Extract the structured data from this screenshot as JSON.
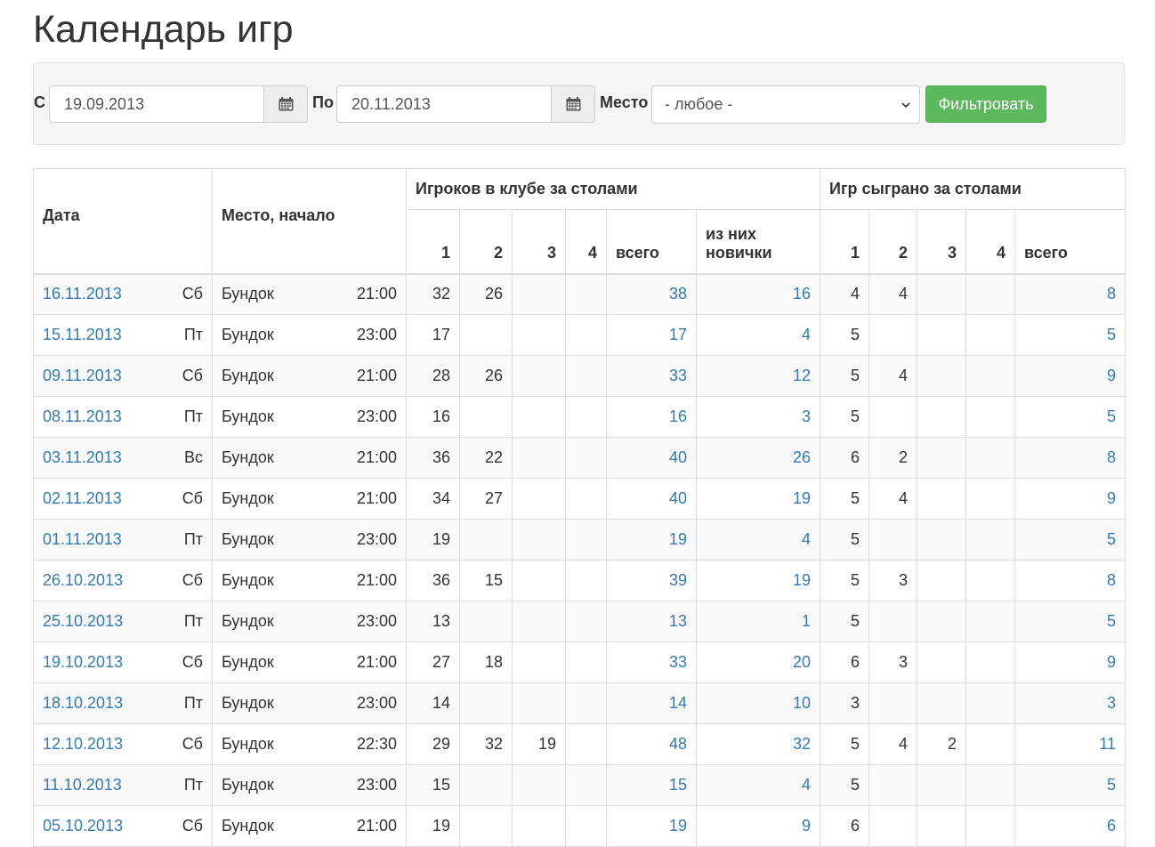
{
  "page_title": "Календарь игр",
  "filter": {
    "from_label": "С",
    "from_value": "19.09.2013",
    "to_label": "По",
    "to_value": "20.11.2013",
    "place_label": "Место",
    "place_value": "- любое -",
    "submit_label": "Фильтровать"
  },
  "table": {
    "headers": {
      "date": "Дата",
      "place_start": "Место, начало",
      "players_group": "Игроков в клубе за столами",
      "games_group": "Игр сыграно за столами",
      "t1": "1",
      "t2": "2",
      "t3": "3",
      "t4": "4",
      "total": "всего",
      "newbies": "из них новички"
    },
    "rows": [
      {
        "date": "16.11.2013",
        "dow": "Сб",
        "place": "Бундок",
        "time": "21:00",
        "p1": "32",
        "p2": "26",
        "p3": "",
        "p4": "",
        "ptotal": "38",
        "pnew": "16",
        "g1": "4",
        "g2": "4",
        "g3": "",
        "g4": "",
        "gtotal": "8"
      },
      {
        "date": "15.11.2013",
        "dow": "Пт",
        "place": "Бундок",
        "time": "23:00",
        "p1": "17",
        "p2": "",
        "p3": "",
        "p4": "",
        "ptotal": "17",
        "pnew": "4",
        "g1": "5",
        "g2": "",
        "g3": "",
        "g4": "",
        "gtotal": "5"
      },
      {
        "date": "09.11.2013",
        "dow": "Сб",
        "place": "Бундок",
        "time": "21:00",
        "p1": "28",
        "p2": "26",
        "p3": "",
        "p4": "",
        "ptotal": "33",
        "pnew": "12",
        "g1": "5",
        "g2": "4",
        "g3": "",
        "g4": "",
        "gtotal": "9"
      },
      {
        "date": "08.11.2013",
        "dow": "Пт",
        "place": "Бундок",
        "time": "23:00",
        "p1": "16",
        "p2": "",
        "p3": "",
        "p4": "",
        "ptotal": "16",
        "pnew": "3",
        "g1": "5",
        "g2": "",
        "g3": "",
        "g4": "",
        "gtotal": "5"
      },
      {
        "date": "03.11.2013",
        "dow": "Вс",
        "place": "Бундок",
        "time": "21:00",
        "p1": "36",
        "p2": "22",
        "p3": "",
        "p4": "",
        "ptotal": "40",
        "pnew": "26",
        "g1": "6",
        "g2": "2",
        "g3": "",
        "g4": "",
        "gtotal": "8"
      },
      {
        "date": "02.11.2013",
        "dow": "Сб",
        "place": "Бундок",
        "time": "21:00",
        "p1": "34",
        "p2": "27",
        "p3": "",
        "p4": "",
        "ptotal": "40",
        "pnew": "19",
        "g1": "5",
        "g2": "4",
        "g3": "",
        "g4": "",
        "gtotal": "9"
      },
      {
        "date": "01.11.2013",
        "dow": "Пт",
        "place": "Бундок",
        "time": "23:00",
        "p1": "19",
        "p2": "",
        "p3": "",
        "p4": "",
        "ptotal": "19",
        "pnew": "4",
        "g1": "5",
        "g2": "",
        "g3": "",
        "g4": "",
        "gtotal": "5"
      },
      {
        "date": "26.10.2013",
        "dow": "Сб",
        "place": "Бундок",
        "time": "21:00",
        "p1": "36",
        "p2": "15",
        "p3": "",
        "p4": "",
        "ptotal": "39",
        "pnew": "19",
        "g1": "5",
        "g2": "3",
        "g3": "",
        "g4": "",
        "gtotal": "8"
      },
      {
        "date": "25.10.2013",
        "dow": "Пт",
        "place": "Бундок",
        "time": "23:00",
        "p1": "13",
        "p2": "",
        "p3": "",
        "p4": "",
        "ptotal": "13",
        "pnew": "1",
        "g1": "5",
        "g2": "",
        "g3": "",
        "g4": "",
        "gtotal": "5"
      },
      {
        "date": "19.10.2013",
        "dow": "Сб",
        "place": "Бундок",
        "time": "21:00",
        "p1": "27",
        "p2": "18",
        "p3": "",
        "p4": "",
        "ptotal": "33",
        "pnew": "20",
        "g1": "6",
        "g2": "3",
        "g3": "",
        "g4": "",
        "gtotal": "9"
      },
      {
        "date": "18.10.2013",
        "dow": "Пт",
        "place": "Бундок",
        "time": "23:00",
        "p1": "14",
        "p2": "",
        "p3": "",
        "p4": "",
        "ptotal": "14",
        "pnew": "10",
        "g1": "3",
        "g2": "",
        "g3": "",
        "g4": "",
        "gtotal": "3"
      },
      {
        "date": "12.10.2013",
        "dow": "Сб",
        "place": "Бундок",
        "time": "22:30",
        "p1": "29",
        "p2": "32",
        "p3": "19",
        "p4": "",
        "ptotal": "48",
        "pnew": "32",
        "g1": "5",
        "g2": "4",
        "g3": "2",
        "g4": "",
        "gtotal": "11"
      },
      {
        "date": "11.10.2013",
        "dow": "Пт",
        "place": "Бундок",
        "time": "23:00",
        "p1": "15",
        "p2": "",
        "p3": "",
        "p4": "",
        "ptotal": "15",
        "pnew": "4",
        "g1": "5",
        "g2": "",
        "g3": "",
        "g4": "",
        "gtotal": "5"
      },
      {
        "date": "05.10.2013",
        "dow": "Сб",
        "place": "Бундок",
        "time": "21:00",
        "p1": "19",
        "p2": "",
        "p3": "",
        "p4": "",
        "ptotal": "19",
        "pnew": "9",
        "g1": "6",
        "g2": "",
        "g3": "",
        "g4": "",
        "gtotal": "6"
      }
    ]
  }
}
